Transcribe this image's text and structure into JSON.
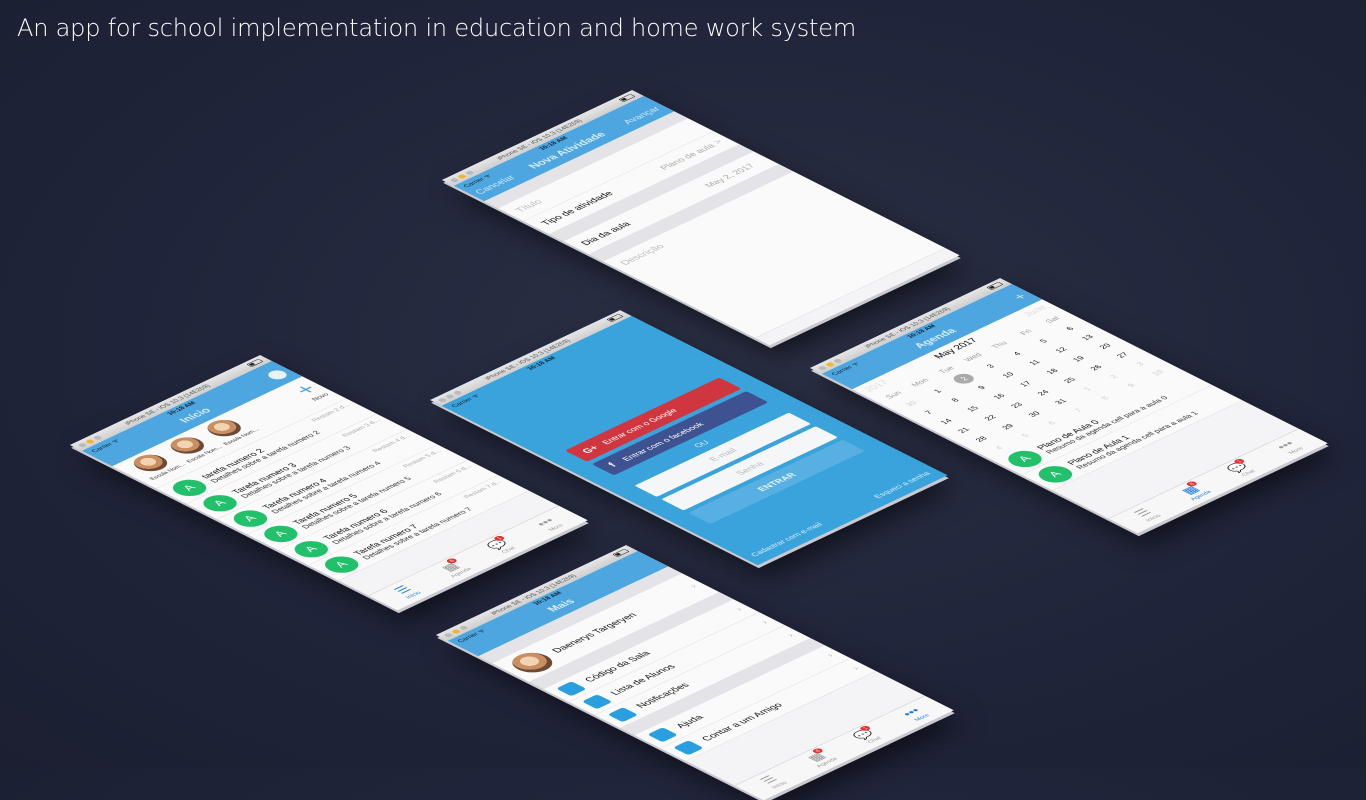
{
  "headline": "An app for school implementation in education and home work system",
  "sim": {
    "device": "iPhone SE - iOS 10.3 (14E269)",
    "carrier": "Carrier ᯤ",
    "time": "10:18 AM"
  },
  "nova": {
    "title": "Nova Atividade",
    "cancel": "Cancelar",
    "next": "Avançar",
    "titulo_ph": "Título",
    "tipo": "Tipo de atividade",
    "tipo_val": "Plano de aula",
    "dia": "Dia da aula",
    "dia_val": "May 2, 2017",
    "descricao_ph": "Descrição",
    "chev": ">"
  },
  "login": {
    "google": "Entrar com o Google",
    "google_icon": "G+",
    "facebook": "Entrar com o facebook",
    "facebook_icon": "f",
    "ou": "OU",
    "email_ph": "E-mail",
    "senha_ph": "Senha",
    "entrar": "ENTRAR",
    "cadastrar": "Cadastrar com e-mail",
    "esqueci": "Esqueci a senha"
  },
  "inicio": {
    "title": "Início",
    "plus": "+",
    "novo": "Novo",
    "stories": [
      "Escola Nom...",
      "Escola Nom...",
      "Escola Nom..."
    ],
    "tasks": [
      {
        "avatar": "A",
        "name": "tarefa numero 2",
        "detail": "Detalhes sobre a tarefa numero 2",
        "remain": "Restam 2 d..."
      },
      {
        "avatar": "A",
        "name": "Tarefa numero 3",
        "detail": "Detalhes sobre a tarefa numero 3",
        "remain": "Restam 3 d..."
      },
      {
        "avatar": "A",
        "name": "Tarefa numero 4",
        "detail": "Detalhes sobre a tarefa numero 4",
        "remain": "Restam 4 d..."
      },
      {
        "avatar": "A",
        "name": "Tarefa numero 5",
        "detail": "Detalhes sobre a tarefa numero 5",
        "remain": "Restam 5 d..."
      },
      {
        "avatar": "A",
        "name": "Tarefa numero 6",
        "detail": "Detalhes sobre a tarefa numero 6",
        "remain": "Restam 6 d..."
      },
      {
        "avatar": "A",
        "name": "Tarefa numero 7",
        "detail": "Detalhes sobre a tarefa numero 7",
        "remain": "Restam 7 d..."
      }
    ]
  },
  "tabs": [
    {
      "label": "Início",
      "icon": "☰"
    },
    {
      "label": "Agenda",
      "icon": "▦",
      "badge": "6"
    },
    {
      "label": "Chat",
      "icon": "💬",
      "badge": "1"
    },
    {
      "label": "More",
      "icon": "•••"
    }
  ],
  "agenda": {
    "title": "Agenda",
    "plus": "+",
    "month": "May 2017",
    "prev_year": "2017",
    "next_month": "June",
    "weekdays": [
      "Sun",
      "Mon",
      "Tue",
      "Wed",
      "Thu",
      "Fri",
      "Sat"
    ],
    "days": [
      "30",
      "1",
      "2",
      "3",
      "4",
      "5",
      "6",
      "7",
      "8",
      "9",
      "10",
      "11",
      "12",
      "13",
      "14",
      "15",
      "16",
      "17",
      "18",
      "19",
      "20",
      "21",
      "22",
      "23",
      "24",
      "25",
      "26",
      "27",
      "28",
      "29",
      "30",
      "31",
      "1",
      "2",
      "3",
      "4",
      "5",
      "6",
      "7",
      "8",
      "9",
      "10"
    ],
    "selected": "2",
    "items": [
      {
        "avatar": "A",
        "name": "Plano de Aula 0",
        "detail": "Resumo da agenda cell para a aula 0"
      },
      {
        "avatar": "A",
        "name": "Plano de Aula 1",
        "detail": "Resumo da agenda cell para a aula 1"
      }
    ]
  },
  "mais": {
    "title": "Mais",
    "user": "Daenerys Targeryen",
    "items": [
      "Código da Sala",
      "Lista de Alunos",
      "Notificações"
    ],
    "items2": [
      "Ajuda",
      "Contar a um Amigo"
    ]
  }
}
